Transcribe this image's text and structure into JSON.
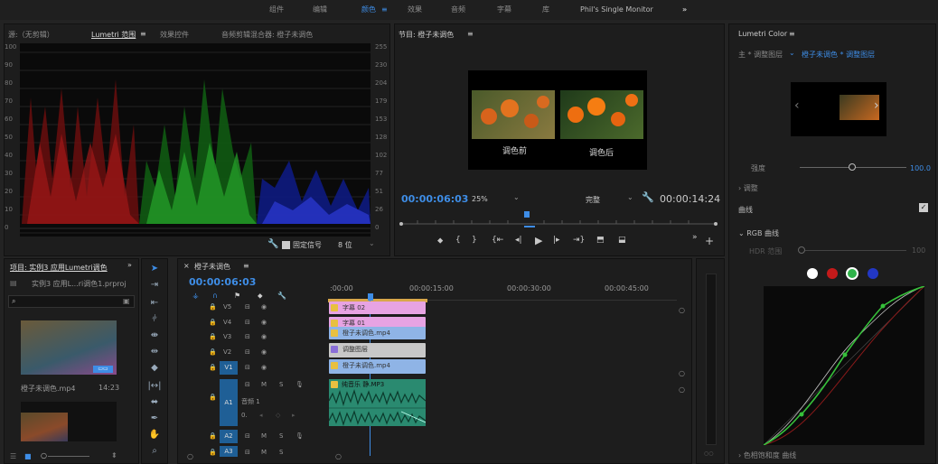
{
  "workspaces": [
    "组件",
    "编辑",
    "颜色",
    "效果",
    "音频",
    "字幕",
    "库",
    "Phil's Single Monitor"
  ],
  "active_workspace": "颜色",
  "workspace_more": "»",
  "scopes": {
    "tabs": [
      "源:（无剪辑）",
      "Lumetri 范围",
      "效果控件",
      "音频剪辑混合器: 橙子未调色"
    ],
    "menu_icon": "≡",
    "left_labels": [
      "100",
      "90",
      "80",
      "70",
      "60",
      "50",
      "40",
      "30",
      "20",
      "10",
      "0"
    ],
    "right_labels": [
      "255",
      "230",
      "204",
      "179",
      "153",
      "128",
      "102",
      "77",
      "51",
      "26",
      "0"
    ],
    "bottom": {
      "clamp": "固定信号",
      "bits": "8 位"
    }
  },
  "program": {
    "title": "节目: 橙子未调色",
    "menu_icon": "≡",
    "caption_before": "调色前",
    "caption_after": "调色后",
    "timecode": "00:00:06:03",
    "zoom": "25%",
    "quality": "完整",
    "duration": "00:00:14:24"
  },
  "lumetri": {
    "title": "Lumetri Color",
    "menu_icon": "≡",
    "breadcrumb": "主 * 调整图层",
    "breadcrumb_link": "橙子未调色 * 调整图层",
    "intensity_label": "强度",
    "intensity_value": "100.0",
    "adjust_label": "调整",
    "curves_label": "曲线",
    "rgb_label": "RGB 曲线",
    "hdr_label": "HDR 范围",
    "hdr_value": "100",
    "hue_sat_label": "色相饱和度 曲线",
    "channel_colors": [
      "#ffffff",
      "#c41a1a",
      "#2fb34a",
      "#2237c4"
    ]
  },
  "project": {
    "title": "项目: 实例3 应用Lumetri调色",
    "more": "»",
    "file": "实例3 应用L...ri调色1.prproj",
    "item_name": "橙子未调色.mp4",
    "item_dur": "14:23"
  },
  "timeline": {
    "title": "橙子未调色",
    "menu_icon": "≡",
    "timecode": "00:00:06:03",
    "ruler": [
      ":00:00",
      "00:00:15:00",
      "00:00:30:00",
      "00:00:45:00"
    ],
    "tracks": [
      {
        "name": "V5",
        "clip": "字幕 02",
        "type": "pink"
      },
      {
        "name": "V4",
        "clip": "字幕 01",
        "type": "pink"
      },
      {
        "name": "V3",
        "clip": "橙子未调色.mp4",
        "type": "blue"
      },
      {
        "name": "V2",
        "clip": "调整图层",
        "type": "grey"
      },
      {
        "name": "V1",
        "clip": "橙子未调色.mp4",
        "type": "blue"
      }
    ],
    "audio_tracks": [
      "A1",
      "A2",
      "A3"
    ],
    "audio_clip": "纯音乐 静.MP3",
    "audio_track_name": "音频 1",
    "audio_level": "0.",
    "m": "M",
    "s": "S"
  }
}
